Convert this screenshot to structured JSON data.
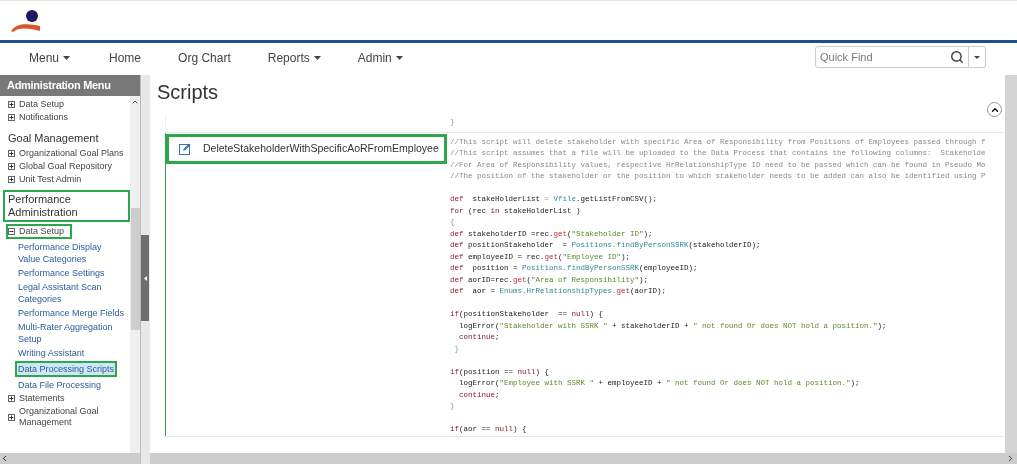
{
  "nav": {
    "items": [
      {
        "label": "Menu",
        "dropdown": true
      },
      {
        "label": "Home",
        "dropdown": false
      },
      {
        "label": "Org Chart",
        "dropdown": false
      },
      {
        "label": "Reports",
        "dropdown": true
      },
      {
        "label": "Admin",
        "dropdown": true
      }
    ],
    "search": {
      "placeholder": "Quick Find"
    }
  },
  "sidebar": {
    "title": "Administration Menu",
    "items": [
      {
        "kind": "node",
        "label": "Data Setup",
        "expanded": false,
        "highlighted": false
      },
      {
        "kind": "node",
        "label": "Notifications",
        "expanded": false,
        "highlighted": false
      },
      {
        "kind": "heading",
        "label": "Goal Management",
        "highlighted": false
      },
      {
        "kind": "node",
        "label": "Organizational Goal Plans",
        "expanded": false,
        "highlighted": false
      },
      {
        "kind": "node",
        "label": "Global Goal Repository",
        "expanded": false,
        "highlighted": false
      },
      {
        "kind": "node",
        "label": "Unit Test Admin",
        "expanded": false,
        "highlighted": false
      },
      {
        "kind": "heading",
        "label": "Performance Administration",
        "highlighted": true
      },
      {
        "kind": "node",
        "label": "Data Setup",
        "expanded": true,
        "highlighted": true,
        "children": [
          {
            "label": "Performance Display Value Categories",
            "selected": false,
            "highlighted": false
          },
          {
            "label": "Performance Settings",
            "selected": false,
            "highlighted": false
          },
          {
            "label": "Legal Assistant Scan Categories",
            "selected": false,
            "highlighted": false
          },
          {
            "label": "Performance Merge Fields",
            "selected": false,
            "highlighted": false
          },
          {
            "label": "Multi-Rater Aggregation Setup",
            "selected": false,
            "highlighted": false
          },
          {
            "label": "Writing Assistant",
            "selected": false,
            "highlighted": false
          },
          {
            "label": "Data Processing Scripts",
            "selected": true,
            "highlighted": true
          },
          {
            "label": "Data File Processing",
            "selected": false,
            "highlighted": false
          }
        ]
      },
      {
        "kind": "node",
        "label": "Statements",
        "expanded": false,
        "highlighted": false
      },
      {
        "kind": "node",
        "label": "Organizational Goal Management",
        "expanded": false,
        "highlighted": false
      }
    ]
  },
  "page": {
    "title": "Scripts"
  },
  "scripts": [
    {
      "highlighted": false,
      "lines": [
        {
          "kind": "code",
          "segments": [
            {
              "kind": "brace",
              "text": "}"
            }
          ]
        }
      ]
    },
    {
      "name": "DeleteStakeholderWithSpecificAoRFromEmployee",
      "highlighted": true,
      "lines": [
        {
          "kind": "code",
          "segments": [
            {
              "kind": "comment",
              "text": "//This script will delete stakeholder with specific Area of Responsibility from Positions of Employees passed through f"
            }
          ]
        },
        {
          "kind": "code",
          "segments": [
            {
              "kind": "comment",
              "text": "//This script assumes that a file will be uploaded to the Data Process that contains the following columns:  Stakeholde"
            }
          ]
        },
        {
          "kind": "code",
          "segments": [
            {
              "kind": "comment",
              "text": "//For Area of Responsibility values, respective HrRelationshipType ID need to be passed which can be found in Pseudo Mo"
            }
          ]
        },
        {
          "kind": "code",
          "segments": [
            {
              "kind": "comment",
              "text": "//The position of the stakeholder or the position to which stakeholder needs to be added can also be identified using P"
            }
          ]
        },
        {
          "kind": "blank"
        },
        {
          "kind": "code",
          "segments": [
            {
              "kind": "keyword",
              "text": "def"
            },
            {
              "kind": "plain",
              "text": "  stakeHolderList "
            },
            {
              "kind": "brace",
              "text": "= "
            },
            {
              "kind": "type",
              "text": "Vfile"
            },
            {
              "kind": "plain",
              "text": ".getListFromCSV();"
            }
          ]
        },
        {
          "kind": "code",
          "segments": [
            {
              "kind": "keyword",
              "text": "for"
            },
            {
              "kind": "plain",
              "text": " (rec "
            },
            {
              "kind": "keyword",
              "text": "in"
            },
            {
              "kind": "plain",
              "text": " stakeHolderList )"
            }
          ]
        },
        {
          "kind": "code",
          "segments": [
            {
              "kind": "brace",
              "text": "{"
            }
          ]
        },
        {
          "kind": "code",
          "segments": [
            {
              "kind": "keyword",
              "text": "def"
            },
            {
              "kind": "plain",
              "text": " stakeholderID =rec."
            },
            {
              "kind": "method",
              "text": "get"
            },
            {
              "kind": "plain",
              "text": "("
            },
            {
              "kind": "string",
              "text": "\"Stakeholder ID\""
            },
            {
              "kind": "plain",
              "text": ");"
            }
          ]
        },
        {
          "kind": "code",
          "segments": [
            {
              "kind": "keyword",
              "text": "def"
            },
            {
              "kind": "plain",
              "text": " positionStakeholder  = "
            },
            {
              "kind": "type",
              "text": "Positions.findByPersonSSRK"
            },
            {
              "kind": "plain",
              "text": "(stakeholderID);"
            }
          ]
        },
        {
          "kind": "code",
          "segments": [
            {
              "kind": "keyword",
              "text": "def"
            },
            {
              "kind": "plain",
              "text": " employeeID = rec."
            },
            {
              "kind": "method",
              "text": "get"
            },
            {
              "kind": "plain",
              "text": "("
            },
            {
              "kind": "string",
              "text": "\"Employee ID\""
            },
            {
              "kind": "plain",
              "text": ");"
            }
          ]
        },
        {
          "kind": "code",
          "segments": [
            {
              "kind": "keyword",
              "text": "def"
            },
            {
              "kind": "plain",
              "text": "  position = "
            },
            {
              "kind": "type",
              "text": "Positions.findByPersonSSRK"
            },
            {
              "kind": "plain",
              "text": "(employeeID);"
            }
          ]
        },
        {
          "kind": "code",
          "segments": [
            {
              "kind": "keyword",
              "text": "def"
            },
            {
              "kind": "plain",
              "text": " aorID=rec."
            },
            {
              "kind": "method",
              "text": "get"
            },
            {
              "kind": "plain",
              "text": "("
            },
            {
              "kind": "string",
              "text": "\"Area of Responsibility\""
            },
            {
              "kind": "plain",
              "text": ");"
            }
          ]
        },
        {
          "kind": "code",
          "segments": [
            {
              "kind": "keyword",
              "text": "def"
            },
            {
              "kind": "plain",
              "text": "  aor = "
            },
            {
              "kind": "type",
              "text": "Enums.HrRelationshipTypes."
            },
            {
              "kind": "method",
              "text": "get"
            },
            {
              "kind": "plain",
              "text": "(aorID);"
            }
          ]
        },
        {
          "kind": "blank"
        },
        {
          "kind": "code",
          "segments": [
            {
              "kind": "keyword",
              "text": "if"
            },
            {
              "kind": "plain",
              "text": "(positionStakeholder  == "
            },
            {
              "kind": "keyword",
              "text": "null"
            },
            {
              "kind": "plain",
              "text": ") {"
            }
          ]
        },
        {
          "kind": "code",
          "segments": [
            {
              "kind": "plain",
              "text": "  logError("
            },
            {
              "kind": "string",
              "text": "\"Stakeholder with SSRK \""
            },
            {
              "kind": "plain",
              "text": " + stakeholderID + "
            },
            {
              "kind": "string",
              "text": "\" not found Or does NOT hold a position.\""
            },
            {
              "kind": "plain",
              "text": ");"
            }
          ]
        },
        {
          "kind": "code",
          "segments": [
            {
              "kind": "keyword",
              "text": "  continue"
            },
            {
              "kind": "plain",
              "text": ";"
            }
          ]
        },
        {
          "kind": "code",
          "segments": [
            {
              "kind": "brace",
              "text": " }"
            }
          ]
        },
        {
          "kind": "blank"
        },
        {
          "kind": "code",
          "segments": [
            {
              "kind": "keyword",
              "text": "if"
            },
            {
              "kind": "plain",
              "text": "(position == "
            },
            {
              "kind": "keyword",
              "text": "null"
            },
            {
              "kind": "plain",
              "text": ") {"
            }
          ]
        },
        {
          "kind": "code",
          "segments": [
            {
              "kind": "plain",
              "text": "  logError("
            },
            {
              "kind": "string",
              "text": "\"Employee with SSRK \""
            },
            {
              "kind": "plain",
              "text": " + employeeID + "
            },
            {
              "kind": "string",
              "text": "\" not found Or does NOT hold a position.\""
            },
            {
              "kind": "plain",
              "text": ");"
            }
          ]
        },
        {
          "kind": "code",
          "segments": [
            {
              "kind": "keyword",
              "text": "  continue"
            },
            {
              "kind": "plain",
              "text": ";"
            }
          ]
        },
        {
          "kind": "code",
          "segments": [
            {
              "kind": "brace",
              "text": "}"
            }
          ]
        },
        {
          "kind": "blank"
        },
        {
          "kind": "code",
          "segments": [
            {
              "kind": "keyword",
              "text": "if"
            },
            {
              "kind": "plain",
              "text": "(aor == "
            },
            {
              "kind": "keyword",
              "text": "null"
            },
            {
              "kind": "plain",
              "text": ") {"
            }
          ]
        }
      ]
    }
  ]
}
